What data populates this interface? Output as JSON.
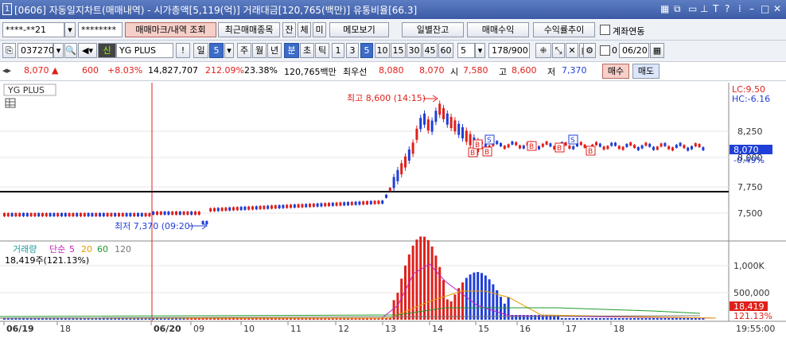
{
  "window": {
    "number": "1",
    "title": "[0606] 자동일지차트(매매내역) - 시가총액[5,119(억)] 거래대금[120,765(백만)] 유통비율[66.3]",
    "icons": [
      "window-list-icon",
      "copy-icon",
      "pin-icon",
      "text-icon",
      "help-icon",
      "menu-icon",
      "minimize-icon",
      "maximize-icon",
      "close-icon"
    ]
  },
  "toolbar1": {
    "account": "****-**21",
    "password": "********",
    "btn_trade_mark": "매매마크/내역 조회",
    "btn_recent": "최근매매종목",
    "btn_jan": "잔",
    "btn_che": "체",
    "btn_mi": "미",
    "btn_memo": "메모보기",
    "btn_daily_balance": "일별잔고",
    "btn_trade_profit": "매매수익",
    "btn_return_trend": "수익률추이",
    "link_label": "계좌연동"
  },
  "toolbar2": {
    "code": "037270",
    "name": "YG PLUS",
    "badge": "신",
    "periods": [
      "일",
      "5",
      "주",
      "월",
      "년",
      "분",
      "초",
      "틱",
      "1",
      "3",
      "5",
      "10",
      "15",
      "30",
      "45",
      "60"
    ],
    "count": "5",
    "page": "178/900",
    "checkbox_value": "0",
    "date": "06/20"
  },
  "quote": {
    "price": "8,070",
    "change": "600",
    "rate": "+8.03%",
    "volume": "14,827,707",
    "vol_ratio": "212.09%",
    "turnover": "23.38%",
    "amount": "120,765백만",
    "best_label": "최우선",
    "bid1": "8,080",
    "bid2": "8,070",
    "open_label": "시",
    "open": "7,580",
    "high_label": "고",
    "high": "8,600",
    "low_label": "저",
    "low": "7,370",
    "buy": "매수",
    "sell": "매도"
  },
  "chart": {
    "name": "YG PLUS",
    "lc": "LC:9.50",
    "hc": "HC:-6.16",
    "max_label": "최고 8,600 (14:15)",
    "min_label": "최저 7,370 (09:20)",
    "yticks": [
      "8,250",
      "8,000",
      "7,750",
      "7,500"
    ],
    "last_price": "8,070",
    "last_pct": "-0.49%",
    "vol_legend": [
      "거래량",
      "단순",
      "5",
      "20",
      "60",
      "120"
    ],
    "vol_info": "18,419주(121.13%)",
    "vol_yticks": [
      "1,000K",
      "500,000"
    ],
    "vol_last": "18,419",
    "vol_pct": "121.13%",
    "xlabels": [
      "06/19",
      "18",
      "06/20",
      "09",
      "10",
      "11",
      "12",
      "13",
      "14",
      "15",
      "16",
      "17",
      "18"
    ],
    "time": "19:55:00",
    "colors": {
      "up": "#e0201b",
      "down": "#1f3fd8",
      "ma5": "#c21fc2",
      "ma20": "#e89b00",
      "ma60": "#1f9a2a",
      "ma120": "#777777"
    },
    "trade_marks": [
      "B",
      "S"
    ]
  }
}
